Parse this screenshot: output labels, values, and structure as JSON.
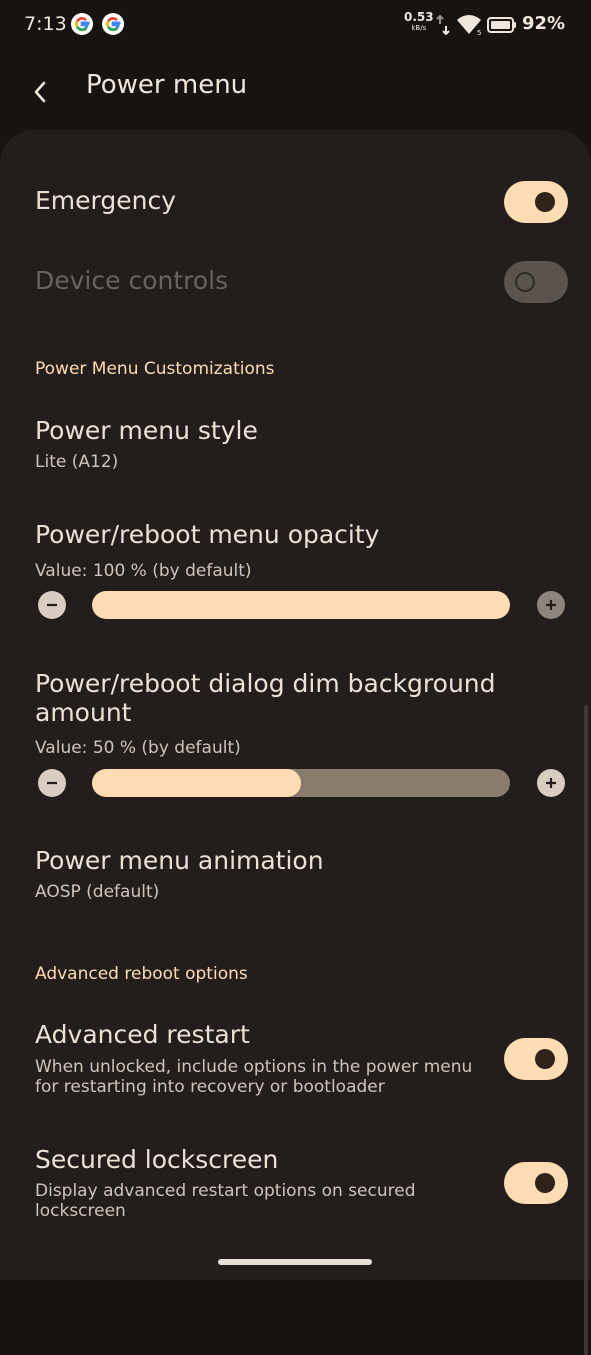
{
  "status_bar": {
    "time": "7:13",
    "net_speed": "0.53",
    "net_unit": "kB/s",
    "battery": "92%"
  },
  "header": {
    "title": "Power menu"
  },
  "settings": {
    "emergency": {
      "title": "Emergency",
      "enabled": true
    },
    "device_controls": {
      "title": "Device controls",
      "enabled": false
    },
    "customizations_header": "Power Menu Customizations",
    "menu_style": {
      "title": "Power menu style",
      "value": "Lite (A12)"
    },
    "opacity": {
      "title": "Power/reboot menu opacity",
      "value_text": "Value: 100 % (by default)",
      "percent": 100
    },
    "dim": {
      "title_line1": "Power/reboot dialog dim background",
      "title_line2": "amount",
      "value_text": "Value: 50 % (by default)",
      "percent": 50
    },
    "animation": {
      "title": "Power menu animation",
      "value": "AOSP (default)"
    },
    "advanced_header": "Advanced reboot options",
    "advanced_restart": {
      "title": "Advanced restart",
      "desc_line1": "When unlocked, include options in the power menu",
      "desc_line2": "for restarting into recovery or bootloader",
      "enabled": true
    },
    "secured_lockscreen": {
      "title": "Secured lockscreen",
      "desc_line1": "Display advanced restart options on secured",
      "desc_line2": "lockscreen",
      "enabled": true
    }
  },
  "colors": {
    "accent": "#ffdcb3",
    "background": "#171310",
    "surface": "#231e1b"
  }
}
